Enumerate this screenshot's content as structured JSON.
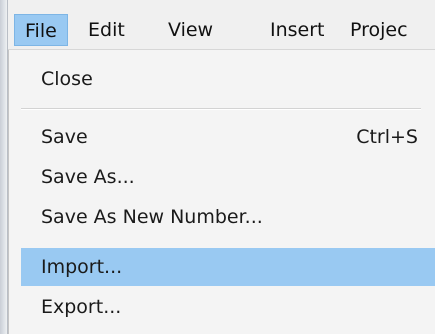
{
  "menubar": {
    "items": [
      {
        "label": "File",
        "active": true
      },
      {
        "label": "Edit"
      },
      {
        "label": "View"
      },
      {
        "label": "Insert"
      },
      {
        "label": "Projec"
      }
    ]
  },
  "file_menu": {
    "items": [
      {
        "label": "Close"
      },
      {
        "label": "Save",
        "shortcut": "Ctrl+S"
      },
      {
        "label": "Save As..."
      },
      {
        "label": "Save As New Number..."
      },
      {
        "label": "Import...",
        "highlighted": true
      },
      {
        "label": "Export..."
      }
    ]
  },
  "colors": {
    "highlight": "#99c9f2",
    "menu_background": "#f4f4f4",
    "text": "#1a1a1a"
  }
}
